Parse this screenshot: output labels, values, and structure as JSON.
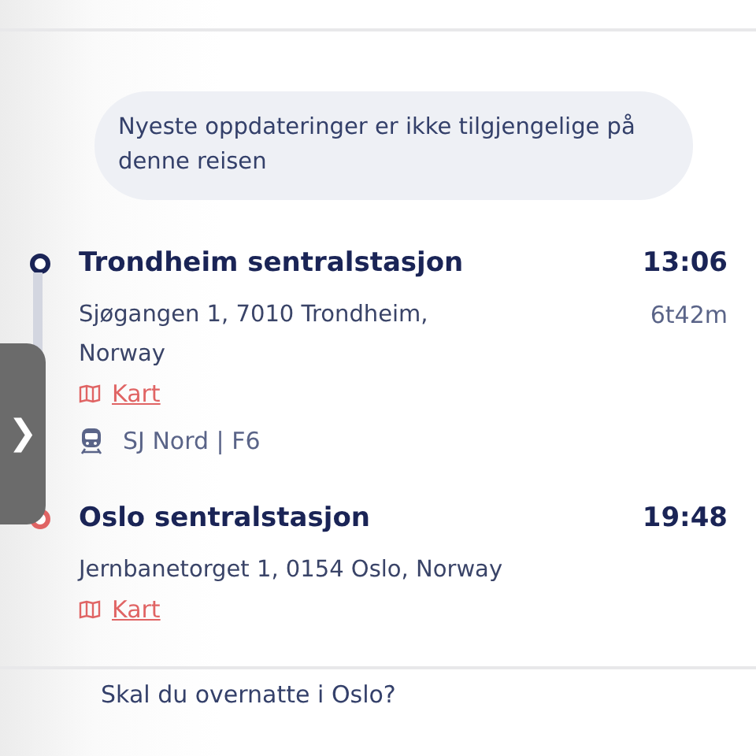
{
  "notice": "Nyeste oppdateringer er ikke tilgjengelige på denne reisen",
  "stops": [
    {
      "name": "Trondheim sentralstasjon",
      "time": "13:06",
      "address": "Sjøgangen 1, 7010 Trondheim, Norway",
      "duration": "6t42m",
      "map_link": "Kart",
      "service": "SJ Nord | F6",
      "color": "#1a2456"
    },
    {
      "name": "Oslo sentralstasjon",
      "time": "19:48",
      "address": "Jernbanetorget 1, 0154 Oslo, Norway",
      "map_link": "Kart",
      "color": "#e06464"
    }
  ],
  "side_tab": {
    "label": "❯"
  },
  "next_section": {
    "title": "Skal du overnatte i Oslo?"
  }
}
